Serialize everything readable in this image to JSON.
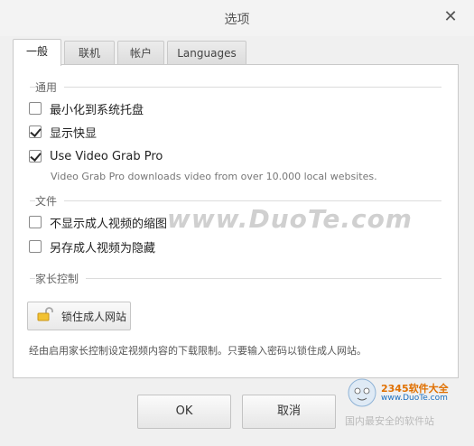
{
  "window": {
    "title": "选项",
    "close_icon": "close-icon"
  },
  "tabs": [
    {
      "label": "一般",
      "active": true
    },
    {
      "label": "联机",
      "active": false
    },
    {
      "label": "帐户",
      "active": false
    },
    {
      "label": "Languages",
      "active": false
    }
  ],
  "general": {
    "section_general": "通用",
    "minimize_to_tray": {
      "label": "最小化到系统托盘",
      "checked": false
    },
    "show_snapshot": {
      "label": "显示快显",
      "checked": true
    },
    "use_video_grab": {
      "label": "Use Video Grab Pro",
      "checked": true
    },
    "video_grab_desc": "Video Grab Pro downloads video from over 10.000 local websites.",
    "section_files": "文件",
    "hide_adult_thumbs": {
      "label": "不显示成人视频的缩图",
      "checked": false
    },
    "save_adult_hidden": {
      "label": "另存成人视频为隐藏",
      "checked": false
    },
    "section_parental": "家长控制",
    "lock_button_label": "锁住成人网站",
    "lock_icon": "lock-icon",
    "parental_note": "经由启用家长控制设定视频内容的下载限制。只要输入密码以锁住成人网站。"
  },
  "footer": {
    "ok_label": "OK",
    "cancel_label": "取消"
  },
  "watermarks": {
    "center": "www.DuoTe.com",
    "corner_title": "2345软件大全",
    "corner_url": "www.DuoTe.com",
    "corner_sub": "国内最安全的软件站"
  }
}
